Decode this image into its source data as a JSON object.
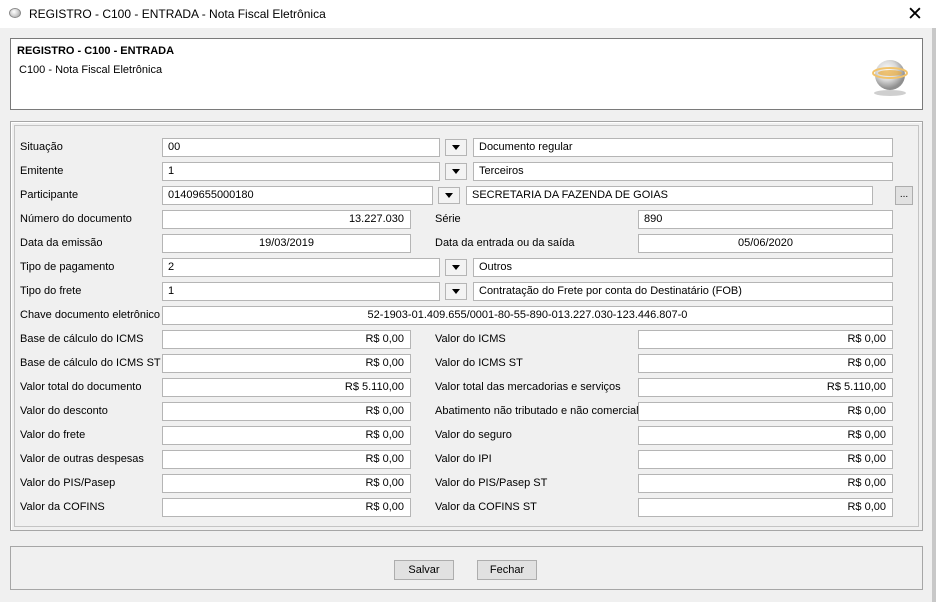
{
  "window": {
    "title": "REGISTRO - C100 - ENTRADA - Nota Fiscal Eletrônica",
    "close_glyph": "✕"
  },
  "header": {
    "title": "REGISTRO - C100 - ENTRADA",
    "subtitle": "C100 - Nota Fiscal Eletrônica",
    "logo_icon": "sped-globe-logo"
  },
  "form": {
    "situacao": {
      "label": "Situação",
      "code": "00",
      "description": "Documento regular"
    },
    "emitente": {
      "label": "Emitente",
      "code": "1",
      "description": "Terceiros"
    },
    "participante": {
      "label": "Participante",
      "code": "01409655000180",
      "description": "SECRETARIA DA FAZENDA DE GOIAS",
      "lookup_label": "..."
    },
    "numero_documento": {
      "label": "Número do documento",
      "value": "13.227.030"
    },
    "serie": {
      "label": "Série",
      "value": "890"
    },
    "data_emissao": {
      "label": "Data da emissão",
      "value": "19/03/2019"
    },
    "data_entrada_saida": {
      "label": "Data da entrada ou da saída",
      "value": "05/06/2020"
    },
    "tipo_pagamento": {
      "label": "Tipo de pagamento",
      "code": "2",
      "description": "Outros"
    },
    "tipo_frete": {
      "label": "Tipo do frete",
      "code": "1",
      "description": "Contratação do Frete por conta do Destinatário (FOB)"
    },
    "chave_documento": {
      "label": "Chave documento eletrônico",
      "value": "52-1903-01.409.655/0001-80-55-890-013.227.030-123.446.807-0"
    },
    "base_icms": {
      "label": "Base de cálculo do ICMS",
      "value": "R$ 0,00"
    },
    "valor_icms": {
      "label": "Valor do ICMS",
      "value": "R$ 0,00"
    },
    "base_icms_st": {
      "label": "Base de cálculo do ICMS ST",
      "value": "R$ 0,00"
    },
    "valor_icms_st": {
      "label": "Valor do ICMS ST",
      "value": "R$ 0,00"
    },
    "valor_total_documento": {
      "label": "Valor total do documento",
      "value": "R$ 5.110,00"
    },
    "valor_total_mercadorias": {
      "label": "Valor total das mercadorias e serviços",
      "value": "R$ 5.110,00"
    },
    "valor_desconto": {
      "label": "Valor do desconto",
      "value": "R$ 0,00"
    },
    "abatimento": {
      "label": "Abatimento não tributado e não comercial",
      "value": "R$ 0,00"
    },
    "valor_frete": {
      "label": "Valor do frete",
      "value": "R$ 0,00"
    },
    "valor_seguro": {
      "label": "Valor do seguro",
      "value": "R$ 0,00"
    },
    "outras_despesas": {
      "label": "Valor de outras despesas",
      "value": "R$ 0,00"
    },
    "valor_ipi": {
      "label": "Valor do IPI",
      "value": "R$ 0,00"
    },
    "valor_pis": {
      "label": "Valor do PIS/Pasep",
      "value": "R$ 0,00"
    },
    "valor_pis_st": {
      "label": "Valor do PIS/Pasep ST",
      "value": "R$ 0,00"
    },
    "valor_cofins": {
      "label": "Valor da COFINS",
      "value": "R$ 0,00"
    },
    "valor_cofins_st": {
      "label": "Valor da COFINS ST",
      "value": "R$ 0,00"
    }
  },
  "footer": {
    "save_label": "Salvar",
    "close_label": "Fechar"
  }
}
